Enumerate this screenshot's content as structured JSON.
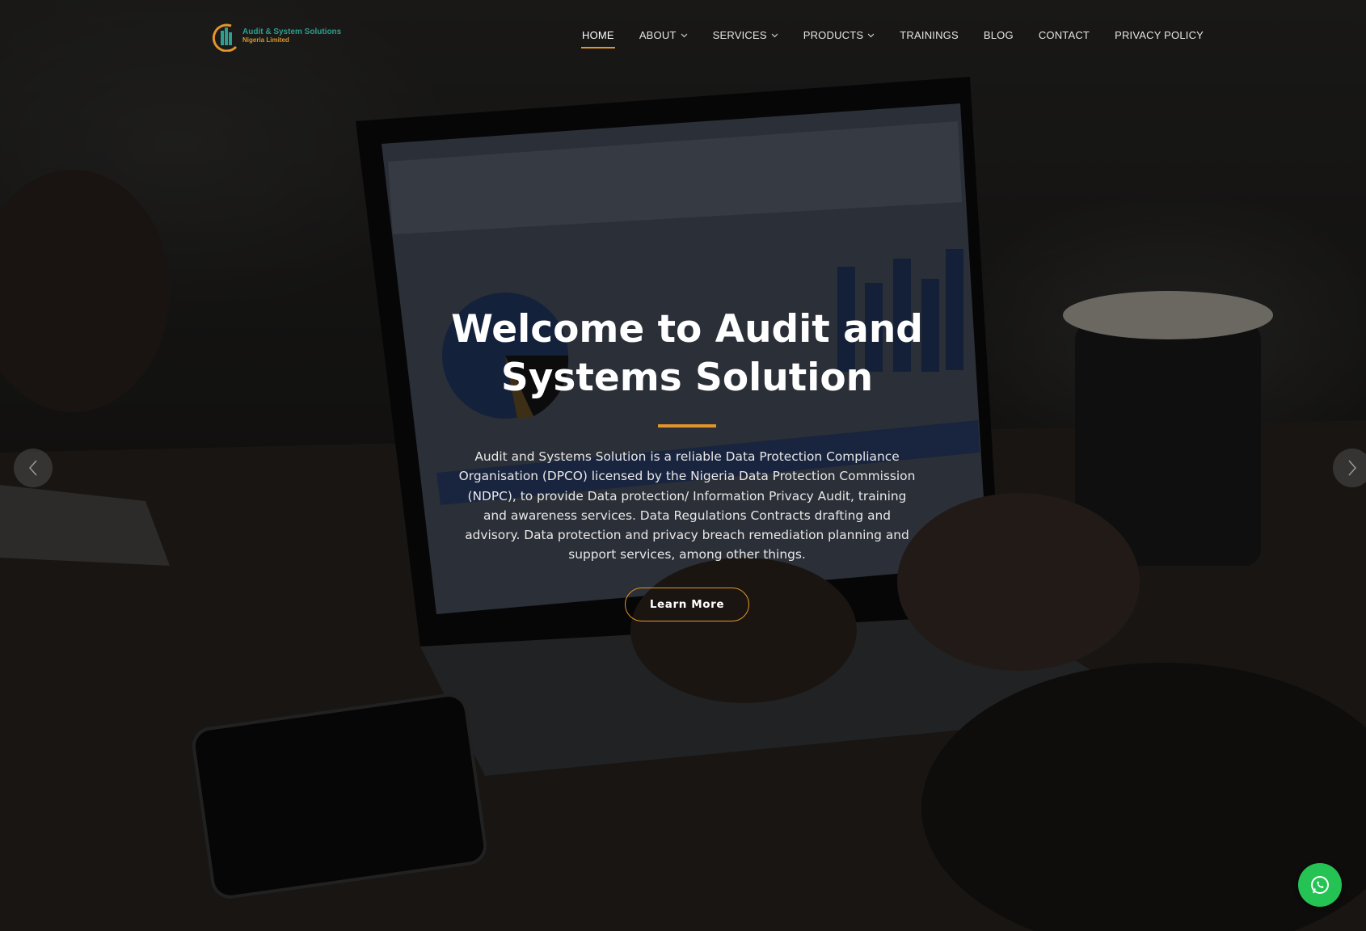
{
  "site": {
    "logo": {
      "line1": "Audit & System Solutions",
      "line2": "Nigeria Limited",
      "icon": "logo-mark-icon"
    }
  },
  "nav": {
    "items": [
      {
        "label": "HOME",
        "active": true,
        "dropdown": false
      },
      {
        "label": "ABOUT",
        "active": false,
        "dropdown": true
      },
      {
        "label": "SERVICES",
        "active": false,
        "dropdown": true
      },
      {
        "label": "PRODUCTS",
        "active": false,
        "dropdown": true
      },
      {
        "label": "TRAININGS",
        "active": false,
        "dropdown": false
      },
      {
        "label": "BLOG",
        "active": false,
        "dropdown": false
      },
      {
        "label": "CONTACT",
        "active": false,
        "dropdown": false
      },
      {
        "label": "PRIVACY POLICY",
        "active": false,
        "dropdown": false
      }
    ]
  },
  "hero": {
    "title_line1": "Welcome to Audit and",
    "title_line2": "Systems Solution",
    "description": "Audit and Systems Solution is a reliable Data Protection Compliance Organisation (DPCO) licensed by the Nigeria Data Protection Commission (NDPC), to provide Data protection/ Information Privacy Audit, training and awareness services. Data Regulations Contracts drafting and advisory. Data protection and privacy breach remediation planning and support services, among other things.",
    "button_label": "Learn More"
  },
  "carousel": {
    "prev_icon": "chevron-left-icon",
    "next_icon": "chevron-right-icon"
  },
  "floating": {
    "whatsapp_icon": "whatsapp-icon"
  },
  "colors": {
    "accent": "#e2952b",
    "whatsapp": "#25c254",
    "text": "#ffffff"
  }
}
